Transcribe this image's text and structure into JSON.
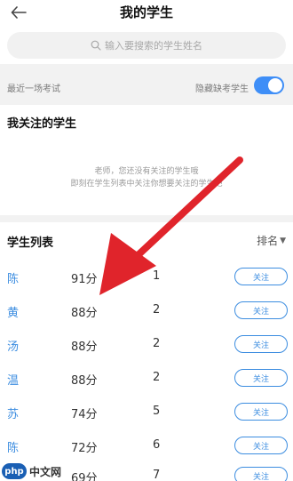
{
  "header": {
    "title": "我的学生"
  },
  "search": {
    "placeholder": "输入要搜索的学生姓名"
  },
  "filter": {
    "left_label": "最近一场考试",
    "right_label": "隐藏缺考学生",
    "hide_absent_on": true
  },
  "follow_section": {
    "title": "我关注的学生",
    "empty_line1": "老师，您还没有关注的学生哦",
    "empty_line2": "即刻在学生列表中关注你想要关注的学生吧"
  },
  "list": {
    "title": "学生列表",
    "sort_label": "排名",
    "follow_label": "关注",
    "rows": [
      {
        "name": "陈",
        "score": "91分",
        "rank": "1"
      },
      {
        "name": "黄",
        "score": "88分",
        "rank": "2"
      },
      {
        "name": "汤",
        "score": "88分",
        "rank": "2"
      },
      {
        "name": "温",
        "score": "88分",
        "rank": "2"
      },
      {
        "name": "苏",
        "score": "74分",
        "rank": "5"
      },
      {
        "name": "陈",
        "score": "72分",
        "rank": "6"
      },
      {
        "name": "",
        "score": "69分",
        "rank": "7"
      }
    ]
  },
  "watermark": {
    "logo": "php",
    "text": "中文网"
  },
  "colors": {
    "accent": "#3c8de0",
    "toggle": "#3e8ef7",
    "annotation_arrow": "#e0242b"
  }
}
